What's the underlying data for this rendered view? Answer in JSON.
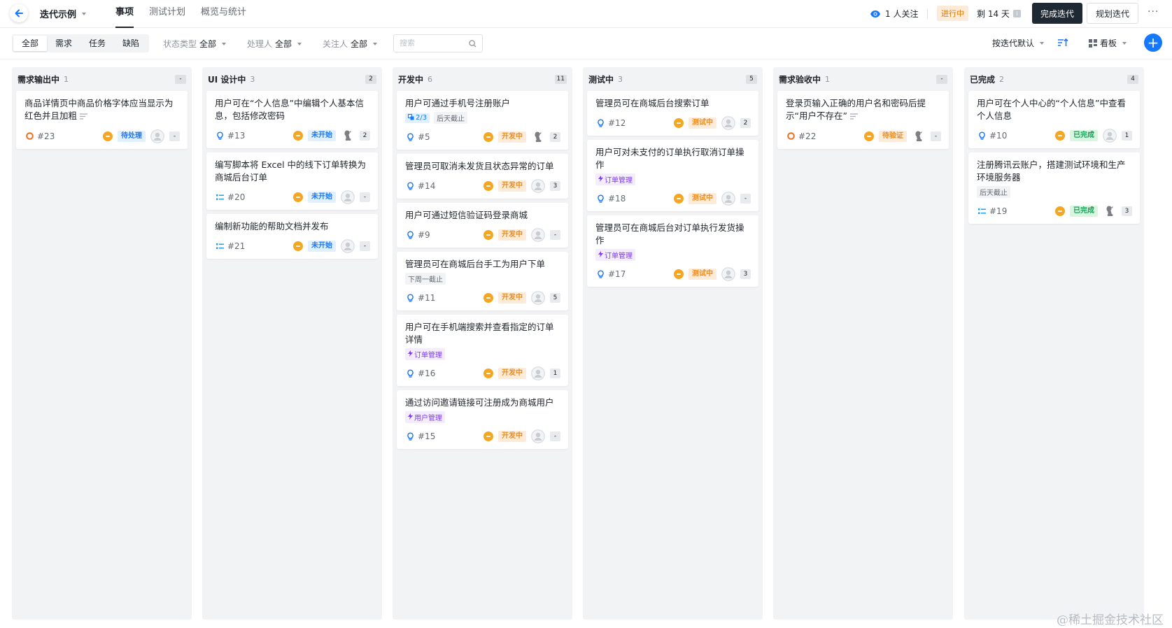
{
  "header": {
    "project_title": "迭代示例",
    "tabs": [
      {
        "label": "事项",
        "active": true
      },
      {
        "label": "测试计划",
        "active": false
      },
      {
        "label": "概览与统计",
        "active": false
      }
    ],
    "watchers": "1 人关注",
    "status": "进行中",
    "remaining": "剩 14 天",
    "info_mark": "i",
    "complete_button": "完成迭代",
    "plan_button": "规划迭代",
    "more": "···"
  },
  "filters": {
    "segments": [
      "全部",
      "需求",
      "任务",
      "缺陷"
    ],
    "active_segment": "全部",
    "status_type_label": "状态类型",
    "status_type_value": "全部",
    "assignee_label": "处理人",
    "assignee_value": "全部",
    "watcher_label": "关注人",
    "watcher_value": "全部",
    "search_placeholder": "搜索",
    "sort_label": "按迭代默认",
    "view_label": "看板",
    "add": "+"
  },
  "colors": {
    "accent": "#1677ff",
    "dark_button": "#1f2933",
    "column_bg": "#f2f3f5",
    "status_blue": "#1677ff",
    "status_orange": "#f08b16",
    "status_green": "#18a058",
    "tag_purple": "#7f3bf5"
  },
  "columns": [
    {
      "title": "需求输出中",
      "count": "1",
      "badge": "-",
      "cards": [
        {
          "title": "商品详情页中商品价格字体应当显示为红色并且加粗",
          "has_desc": true,
          "type": "defect-icon",
          "id": "#23",
          "status": "待处理",
          "status_color": "blue",
          "avatar": "empty",
          "points": "-"
        }
      ]
    },
    {
      "title": "UI 设计中",
      "count": "3",
      "badge": "2",
      "cards": [
        {
          "title": "用户可在“个人信息”中编辑个人基本信息，包括修改密码",
          "type": "story-icon",
          "id": "#13",
          "status": "未开始",
          "status_color": "blue",
          "avatar": "photo",
          "points": "2"
        },
        {
          "title": "编写脚本将 Excel 中的线下订单转换为商城后台订单",
          "type": "task-icon",
          "id": "#20",
          "status": "未开始",
          "status_color": "blue",
          "avatar": "empty",
          "points": "-"
        },
        {
          "title": "编制新功能的帮助文档并发布",
          "type": "task-icon",
          "id": "#21",
          "status": "未开始",
          "status_color": "blue",
          "avatar": "empty",
          "points": "-"
        }
      ]
    },
    {
      "title": "开发中",
      "count": "6",
      "badge": "11",
      "cards": [
        {
          "title": "用户可通过手机号注册账户",
          "subtask": "2/3",
          "due": "后天截止",
          "type": "story-icon",
          "id": "#5",
          "status": "开发中",
          "status_color": "orange",
          "avatar": "photo",
          "points": "2"
        },
        {
          "title": "管理员可取消未发货且状态异常的订单",
          "type": "story-icon",
          "id": "#14",
          "status": "开发中",
          "status_color": "orange",
          "avatar": "empty",
          "points": "3"
        },
        {
          "title": "用户可通过短信验证码登录商城",
          "type": "story-icon",
          "id": "#9",
          "status": "开发中",
          "status_color": "orange",
          "avatar": "empty",
          "points": "-"
        },
        {
          "title": "管理员可在商城后台手工为用户下单",
          "due": "下周一截止",
          "type": "story-icon",
          "id": "#11",
          "status": "开发中",
          "status_color": "orange",
          "avatar": "empty",
          "points": "5"
        },
        {
          "title": "用户可在手机端搜索并查看指定的订单详情",
          "tag": "订单管理",
          "type": "story-icon",
          "id": "#16",
          "status": "开发中",
          "status_color": "orange",
          "avatar": "empty",
          "points": "1"
        },
        {
          "title": "通过访问邀请链接可注册成为商城用户",
          "tag": "用户管理",
          "type": "story-icon",
          "id": "#15",
          "status": "开发中",
          "status_color": "orange",
          "avatar": "empty",
          "points": "-"
        }
      ]
    },
    {
      "title": "测试中",
      "count": "3",
      "badge": "5",
      "cards": [
        {
          "title": "管理员可在商城后台搜索订单",
          "type": "story-icon",
          "id": "#12",
          "status": "测试中",
          "status_color": "orange",
          "avatar": "empty",
          "points": "2"
        },
        {
          "title": "用户可对未支付的订单执行取消订单操作",
          "tag": "订单管理",
          "type": "story-icon",
          "id": "#18",
          "status": "测试中",
          "status_color": "orange",
          "avatar": "empty",
          "points": "-"
        },
        {
          "title": "管理员可在商城后台对订单执行发货操作",
          "tag": "订单管理",
          "type": "story-icon",
          "id": "#17",
          "status": "测试中",
          "status_color": "orange",
          "avatar": "empty",
          "points": "3"
        }
      ]
    },
    {
      "title": "需求验收中",
      "count": "1",
      "badge": "-",
      "cards": [
        {
          "title": "登录页输入正确的用户名和密码后提示“用户不存在”",
          "has_desc": true,
          "type": "defect-icon",
          "id": "#22",
          "status": "待验证",
          "status_color": "orange",
          "avatar": "photo",
          "points": "-"
        }
      ]
    },
    {
      "title": "已完成",
      "count": "2",
      "badge": "4",
      "cards": [
        {
          "title": "用户可在个人中心的“个人信息”中查看个人信息",
          "type": "story-icon",
          "id": "#10",
          "status": "已完成",
          "status_color": "green",
          "avatar": "empty",
          "points": "1"
        },
        {
          "title": "注册腾讯云账户，搭建测试环境和生产环境服务器",
          "due": "后天截止",
          "type": "task-icon",
          "id": "#19",
          "status": "已完成",
          "status_color": "green",
          "avatar": "photo",
          "points": "3"
        }
      ]
    }
  ],
  "watermark": "@稀土掘金技术社区"
}
